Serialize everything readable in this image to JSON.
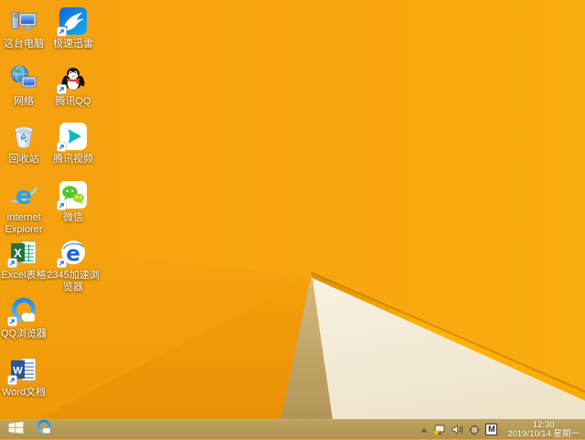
{
  "wallpaper": {
    "base_orange": "#F7A50D",
    "dark_orange_facet": "#EE9506",
    "fold_edge_highlight": "#FFB40A",
    "cream_panel": "#F5EFDD",
    "tan_shadow": "#BDA163",
    "taskbar_color": "#B89C5E"
  },
  "desktop": {
    "icons": [
      {
        "id": "this-pc",
        "label": "这台电脑",
        "shortcut": false
      },
      {
        "id": "xunlei",
        "label": "极速迅雷",
        "shortcut": true
      },
      {
        "id": "network",
        "label": "网络",
        "shortcut": false
      },
      {
        "id": "tencent-qq",
        "label": "腾讯QQ",
        "shortcut": true
      },
      {
        "id": "recycle-bin",
        "label": "回收站",
        "shortcut": false
      },
      {
        "id": "tencent-video",
        "label": "腾讯视频",
        "shortcut": true
      },
      {
        "id": "internet-explorer",
        "label": "Internet Explorer",
        "shortcut": false
      },
      {
        "id": "wechat",
        "label": "微信",
        "shortcut": true
      },
      {
        "id": "excel",
        "label": "Excel表格",
        "shortcut": true
      },
      {
        "id": "2345-browser",
        "label": "2345加速浏览器",
        "shortcut": true
      },
      {
        "id": "qq-browser",
        "label": "QQ浏览器",
        "shortcut": true
      },
      {
        "id": "word",
        "label": "Word文档",
        "shortcut": true
      }
    ]
  },
  "taskbar": {
    "input_indicator": "M",
    "clock": {
      "time": "12:30",
      "date": "2019/10/14 星期一"
    }
  }
}
